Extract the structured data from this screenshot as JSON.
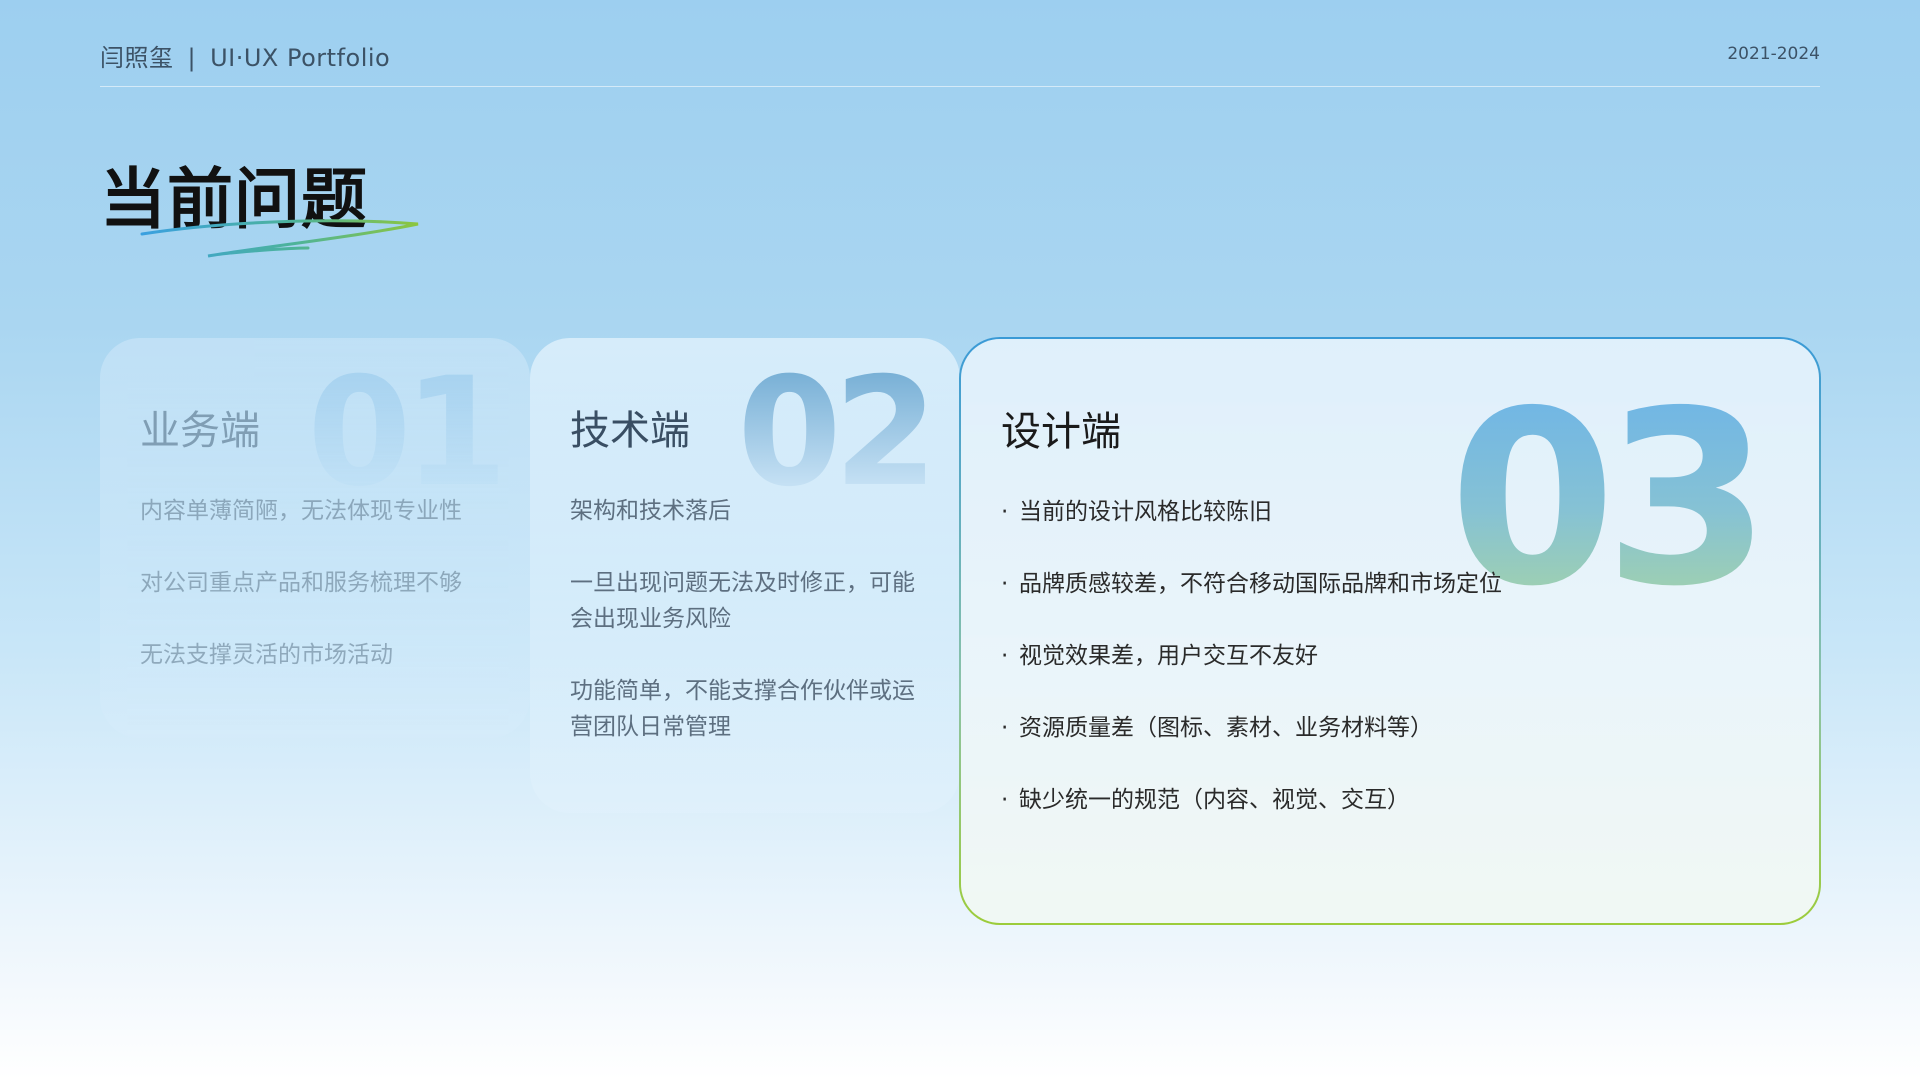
{
  "header": {
    "author": "闫照玺",
    "separator": "|",
    "subtitle": "UI·UX Portfolio",
    "years": "2021-2024"
  },
  "page": {
    "title": "当前问题"
  },
  "colors": {
    "swoosh_blue": "#3aa0e0",
    "swoosh_green": "#8cc63f",
    "card3_border_top": "#3a9ad6",
    "card3_border_bottom": "#9ccc3a"
  },
  "cards": [
    {
      "number": "01",
      "heading": "业务端",
      "items": [
        "内容单薄简陋，无法体现专业性",
        "对公司重点产品和服务梳理不够",
        "无法支撑灵活的市场活动"
      ]
    },
    {
      "number": "02",
      "heading": "技术端",
      "items": [
        "架构和技术落后",
        "一旦出现问题无法及时修正，可能会出现业务风险",
        "功能简单，不能支撑合作伙伴或运营团队日常管理"
      ]
    },
    {
      "number": "03",
      "heading": "设计端",
      "items": [
        "当前的设计风格比较陈旧",
        "品牌质感较差，不符合移动国际品牌和市场定位",
        "视觉效果差，用户交互不友好",
        "资源质量差（图标、素材、业务材料等）",
        "缺少统一的规范（内容、视觉、交互）"
      ]
    }
  ]
}
